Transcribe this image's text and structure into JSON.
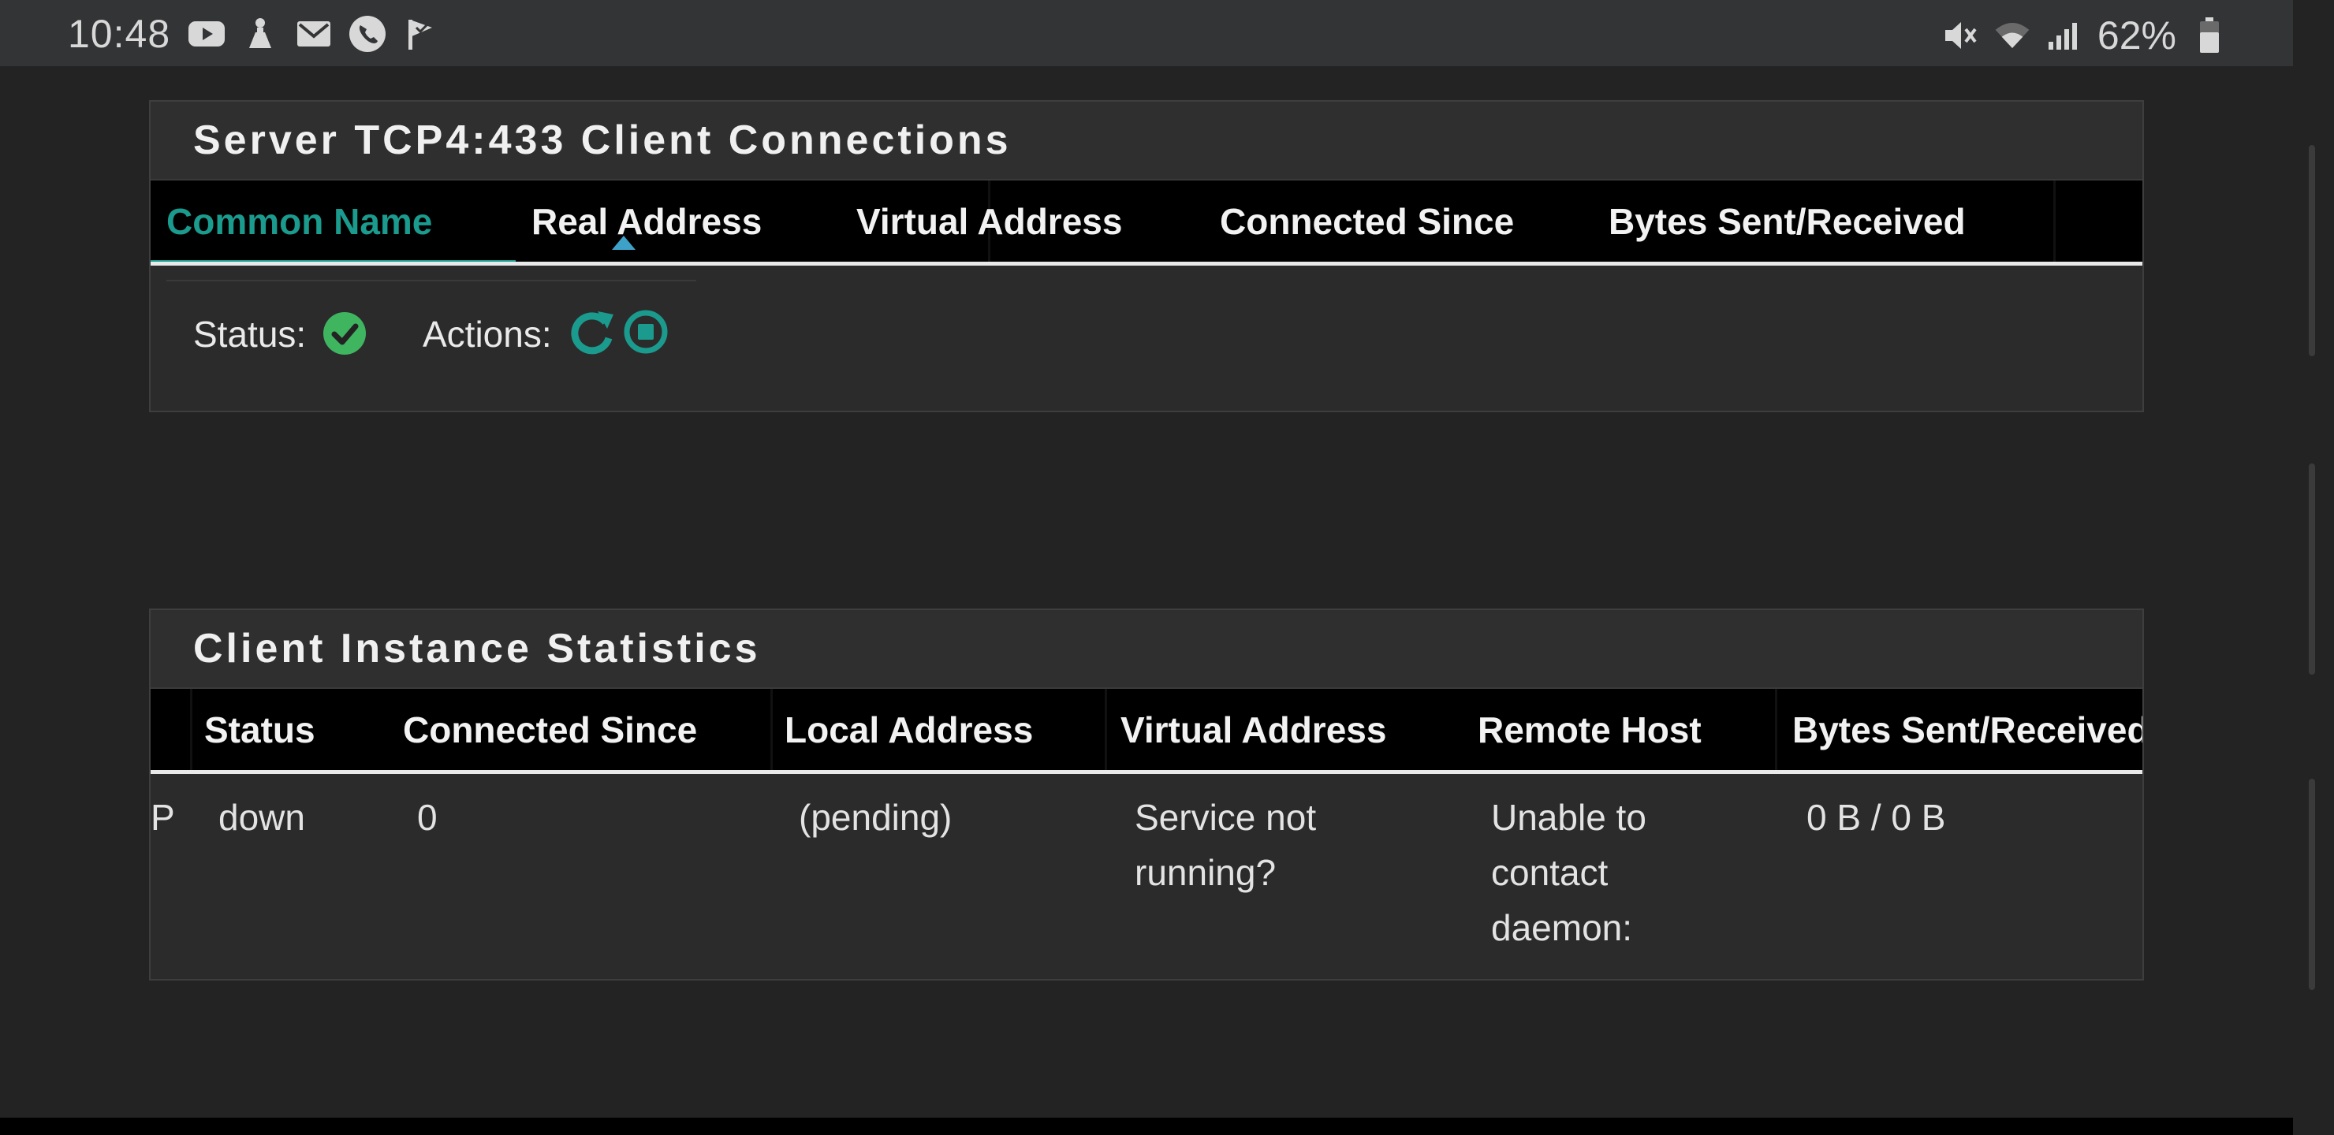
{
  "statusbar": {
    "time": "10:48",
    "notification_icons": [
      "youtube-icon",
      "crane-icon",
      "gmail-icon",
      "phone-icon",
      "check-flag-icon"
    ],
    "system_icons": [
      "mute-icon",
      "wifi-icon",
      "signal-icon",
      "battery-icon"
    ],
    "battery": "62%"
  },
  "server_panel": {
    "title": "Server TCP4:433 Client Connections",
    "columns": [
      "Common Name",
      "Real Address",
      "Virtual Address",
      "Connected Since",
      "Bytes Sent/Received"
    ],
    "sorted_column": "Common Name",
    "status_label": "Status:",
    "actions_label": "Actions:"
  },
  "client_panel": {
    "title": "Client Instance Statistics",
    "columns": [
      "Status",
      "Connected Since",
      "Local Address",
      "Virtual Address",
      "Remote Host",
      "Bytes Sent/Received"
    ],
    "row": {
      "name": "P",
      "status": "down",
      "connected_since": "0",
      "local_address": "(pending)",
      "virtual_address_1": "Service not",
      "virtual_address_2": "running?",
      "remote_host_1": "Unable to",
      "remote_host_2": "contact",
      "remote_host_3": "daemon:",
      "bytes": "0 B / 0 B"
    }
  },
  "colors": {
    "accent": "#1b9a8e",
    "status_ok": "#3fb560",
    "background": "#232323"
  }
}
